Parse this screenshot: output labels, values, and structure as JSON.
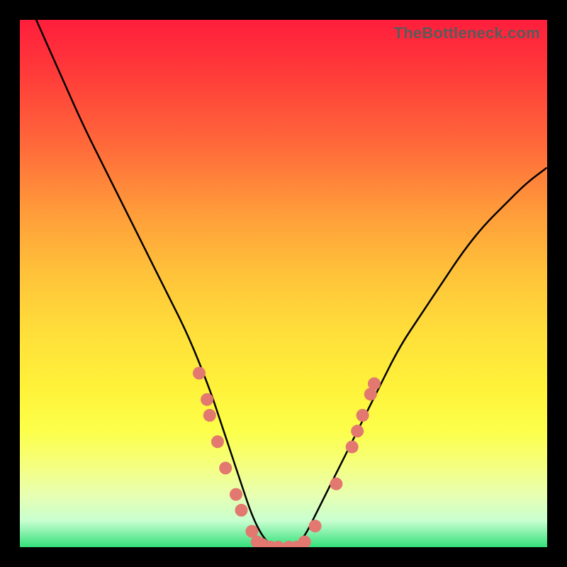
{
  "watermark": "TheBottleneck.com",
  "colors": {
    "frame": "#000000",
    "marker": "#e2786f",
    "curve": "#000000"
  },
  "chart_data": {
    "type": "line",
    "title": "",
    "xlabel": "",
    "ylabel": "",
    "xlim": [
      0,
      100
    ],
    "ylim": [
      0,
      100
    ],
    "grid": false,
    "legend": false,
    "series": [
      {
        "name": "bottleneck-curve",
        "x": [
          0,
          4,
          8,
          12,
          16,
          20,
          24,
          28,
          32,
          36,
          38,
          40,
          42,
          44,
          46,
          48,
          50,
          52,
          54,
          56,
          60,
          64,
          68,
          72,
          76,
          80,
          84,
          88,
          92,
          96,
          100
        ],
        "y": [
          107,
          98,
          89,
          80,
          72,
          64,
          56,
          48,
          40,
          30,
          24,
          18,
          12,
          6,
          2,
          0,
          0,
          0,
          2,
          6,
          14,
          22,
          30,
          38,
          44,
          50,
          56,
          61,
          65,
          69,
          72
        ]
      }
    ],
    "markers": [
      {
        "x": 34,
        "y": 33
      },
      {
        "x": 35.5,
        "y": 28
      },
      {
        "x": 36,
        "y": 25
      },
      {
        "x": 37.5,
        "y": 20
      },
      {
        "x": 39,
        "y": 15
      },
      {
        "x": 41,
        "y": 10
      },
      {
        "x": 42,
        "y": 7
      },
      {
        "x": 44,
        "y": 3
      },
      {
        "x": 45,
        "y": 1
      },
      {
        "x": 46,
        "y": 0.5
      },
      {
        "x": 47.5,
        "y": 0
      },
      {
        "x": 49,
        "y": 0
      },
      {
        "x": 51,
        "y": 0
      },
      {
        "x": 52.5,
        "y": 0
      },
      {
        "x": 54,
        "y": 1
      },
      {
        "x": 56,
        "y": 4
      },
      {
        "x": 60,
        "y": 12
      },
      {
        "x": 63,
        "y": 19
      },
      {
        "x": 64,
        "y": 22
      },
      {
        "x": 65,
        "y": 25
      },
      {
        "x": 66.5,
        "y": 29
      },
      {
        "x": 67.2,
        "y": 31
      }
    ]
  }
}
